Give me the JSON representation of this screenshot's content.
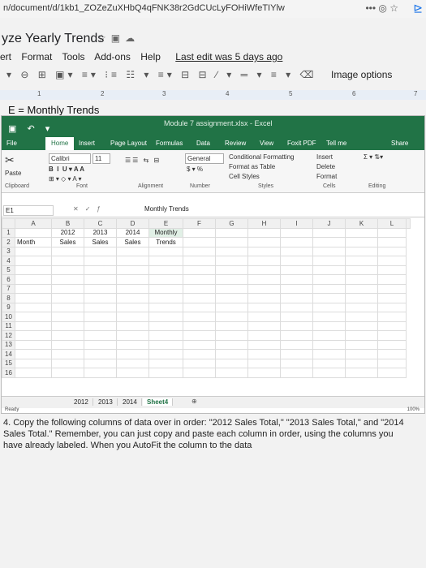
{
  "browser": {
    "url": "n/document/d/1kb1_ZOZeZuXHbQ4qFNK38r2GdCUcLyFOHiWfeTIYlw",
    "controls": "•••"
  },
  "doc": {
    "title": "yze Yearly Trends",
    "menu": [
      "ert",
      "Format",
      "Tools",
      "Add-ons",
      "Help"
    ],
    "last_edit": "Last edit was 5 days ago",
    "image_options": "Image options",
    "ruler": [
      "1",
      "2",
      "3",
      "4",
      "5",
      "6",
      "7"
    ],
    "formula": "E = Monthly Trends"
  },
  "excel": {
    "window_title": "Module 7 assignment.xlsx - Excel",
    "tabs": [
      "File",
      "Home",
      "Insert",
      "Page Layout",
      "Formulas",
      "Data",
      "Review",
      "View",
      "Foxit PDF",
      "Tell me",
      "Share"
    ],
    "ribbon": {
      "font_name": "Calibri",
      "font_size": "11",
      "number_format": "General",
      "conditional": "Conditional Formatting",
      "format_table": "Format as Table",
      "cell_styles": "Cell Styles",
      "insert": "Insert",
      "delete": "Delete",
      "format": "Format",
      "groups": [
        "Clipboard",
        "Font",
        "Alignment",
        "Number",
        "Styles",
        "Cells",
        "Editing"
      ],
      "paste": "Paste"
    },
    "name_box": "E1",
    "formula_value": "Monthly Trends",
    "columns": [
      "A",
      "B",
      "C",
      "D",
      "E",
      "F",
      "G",
      "H",
      "I",
      "J",
      "K",
      "L"
    ],
    "rows": [
      [
        "1",
        "",
        "2012",
        "2013",
        "2014",
        "Monthly",
        "",
        "",
        "",
        "",
        "",
        "",
        ""
      ],
      [
        "2",
        "Month",
        "Sales",
        "Sales",
        "Sales",
        "Trends",
        "",
        "",
        "",
        "",
        "",
        "",
        ""
      ],
      [
        "3",
        "",
        "",
        "",
        "",
        "",
        "",
        "",
        "",
        "",
        "",
        "",
        ""
      ],
      [
        "4",
        "",
        "",
        "",
        "",
        "",
        "",
        "",
        "",
        "",
        "",
        "",
        ""
      ],
      [
        "5",
        "",
        "",
        "",
        "",
        "",
        "",
        "",
        "",
        "",
        "",
        "",
        ""
      ],
      [
        "6",
        "",
        "",
        "",
        "",
        "",
        "",
        "",
        "",
        "",
        "",
        "",
        ""
      ],
      [
        "7",
        "",
        "",
        "",
        "",
        "",
        "",
        "",
        "",
        "",
        "",
        "",
        ""
      ],
      [
        "8",
        "",
        "",
        "",
        "",
        "",
        "",
        "",
        "",
        "",
        "",
        "",
        ""
      ],
      [
        "9",
        "",
        "",
        "",
        "",
        "",
        "",
        "",
        "",
        "",
        "",
        "",
        ""
      ],
      [
        "10",
        "",
        "",
        "",
        "",
        "",
        "",
        "",
        "",
        "",
        "",
        "",
        ""
      ],
      [
        "11",
        "",
        "",
        "",
        "",
        "",
        "",
        "",
        "",
        "",
        "",
        "",
        ""
      ],
      [
        "12",
        "",
        "",
        "",
        "",
        "",
        "",
        "",
        "",
        "",
        "",
        "",
        ""
      ],
      [
        "13",
        "",
        "",
        "",
        "",
        "",
        "",
        "",
        "",
        "",
        "",
        "",
        ""
      ],
      [
        "14",
        "",
        "",
        "",
        "",
        "",
        "",
        "",
        "",
        "",
        "",
        "",
        ""
      ],
      [
        "15",
        "",
        "",
        "",
        "",
        "",
        "",
        "",
        "",
        "",
        "",
        "",
        ""
      ],
      [
        "16",
        "",
        "",
        "",
        "",
        "",
        "",
        "",
        "",
        "",
        "",
        "",
        ""
      ]
    ],
    "sheet_tabs": [
      "2012",
      "2013",
      "2014",
      "Sheet4"
    ],
    "active_sheet": "Sheet4",
    "status_left": "Ready",
    "zoom": "100%"
  },
  "instruction": "4. Copy the following columns of data over in order: \"2012 Sales Total,\" \"2013 Sales Total,\" and \"2014 Sales Total.\" Remember, you can just copy and paste each column in order, using the columns you have already labeled. When you AutoFit the column to the data"
}
